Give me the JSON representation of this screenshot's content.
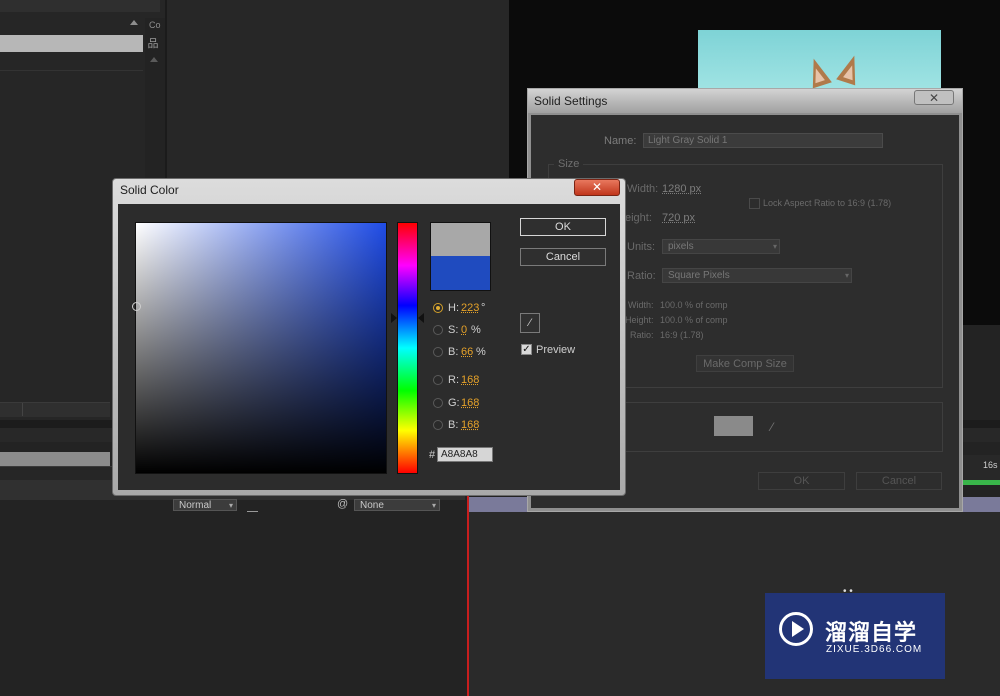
{
  "workspace": {
    "project_panel_col_label": "Co",
    "timeline_time_label": "16s",
    "mode_dropdown": "Normal",
    "mode_dropdown_arrow": "▾",
    "trkmat_dropdown": "None",
    "trkmat_dropdown_arrow": "▾",
    "parent_spiral_icon": "@"
  },
  "solid_settings": {
    "title": "Solid Settings",
    "close_glyph": "✕",
    "name_label": "Name:",
    "name_value": "Light Gray Solid 1",
    "size_group_label": "Size",
    "width_label": "Width:",
    "width_value": "1280 px",
    "height_label": "eight:",
    "height_value": "720 px",
    "lock_aspect_label": "Lock Aspect Ratio to 16:9 (1.78)",
    "units_label": "Units:",
    "units_value": "pixels",
    "pixel_ratio_label": "Ratio:",
    "pixel_ratio_value": "Square Pixels",
    "dd_arrow": "▾",
    "info_width_label": "Width:",
    "info_width_value": "100.0 % of comp",
    "info_height_label": "Height:",
    "info_height_value": "100.0 % of comp",
    "info_ratio_label": "Ratio:",
    "info_ratio_value": "16:9 (1.78)",
    "make_comp_size": "Make Comp Size",
    "swatch_color": "#8a8a8a",
    "ok_label": "OK",
    "cancel_label": "Cancel"
  },
  "solid_color": {
    "title": "Solid Color",
    "close_glyph": "✕",
    "ok_label": "OK",
    "cancel_label": "Cancel",
    "preview_label": "Preview",
    "preview_checked": true,
    "check_glyph": "✓",
    "old_color": "#a8a8a8",
    "new_color": "#1f4bbf",
    "fields": {
      "H": {
        "label": "H:",
        "value": "223",
        "unit": "°"
      },
      "S": {
        "label": "S:",
        "value": "0",
        "unit": "%"
      },
      "Bv": {
        "label": "B:",
        "value": "66",
        "unit": "%"
      },
      "R": {
        "label": "R:",
        "value": "168",
        "unit": ""
      },
      "G": {
        "label": "G:",
        "value": "168",
        "unit": ""
      },
      "Bc": {
        "label": "B:",
        "value": "168",
        "unit": ""
      }
    },
    "selected_mode": "H",
    "hex_prefix": "#",
    "hex_value": "A8A8A8"
  },
  "watermark": {
    "chinese": "溜溜自学",
    "url": "ZIXUE.3D66.COM"
  }
}
